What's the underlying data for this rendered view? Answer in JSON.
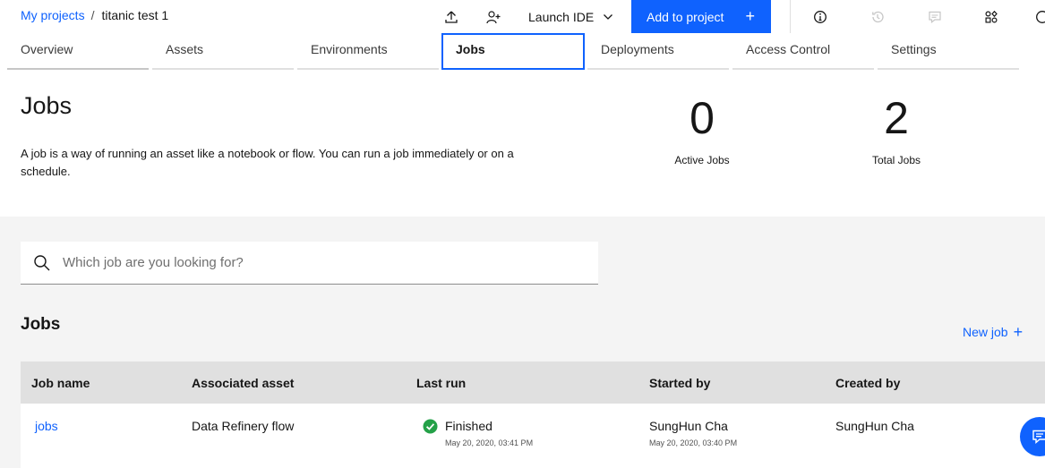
{
  "breadcrumb": {
    "parent": "My projects",
    "separator": "/",
    "current": "titanic test 1"
  },
  "header": {
    "launch_ide_label": "Launch IDE",
    "add_to_project_label": "Add to project",
    "add_icon": "+",
    "icons": [
      "upload-icon",
      "add-collaborator-icon",
      "chevron-down-icon",
      "info-icon",
      "history-icon",
      "comments-icon",
      "apps-icon"
    ]
  },
  "tabs": [
    "Overview",
    "Assets",
    "Environments",
    "Jobs",
    "Deployments",
    "Access Control",
    "Settings"
  ],
  "active_tab": "Jobs",
  "page": {
    "title": "Jobs",
    "description": "A job is a way of running an asset like a notebook or flow. You can run a job immediately or on a schedule."
  },
  "stats": {
    "active": {
      "value": "0",
      "label": "Active Jobs"
    },
    "total": {
      "value": "2",
      "label": "Total Jobs"
    }
  },
  "search": {
    "placeholder": "Which job are you looking for?",
    "value": ""
  },
  "jobs_section": {
    "title": "Jobs",
    "new_job_label": "New job",
    "new_job_icon": "+"
  },
  "table": {
    "headers": [
      "Job name",
      "Associated asset",
      "Last run",
      "Started by",
      "Created by"
    ],
    "rows": [
      {
        "job_name": "jobs",
        "asset": "Data Refinery flow",
        "last_run_status": "Finished",
        "last_run_time": "May 20, 2020, 03:41 PM",
        "started_by": "SungHun Cha",
        "started_time": "May 20, 2020, 03:40 PM",
        "created_by": "SungHun Cha"
      }
    ]
  },
  "colors": {
    "brand": "#0f62fe",
    "success": "#24a148",
    "gray_bg": "#f4f4f4",
    "table_header": "#e0e0e0"
  }
}
